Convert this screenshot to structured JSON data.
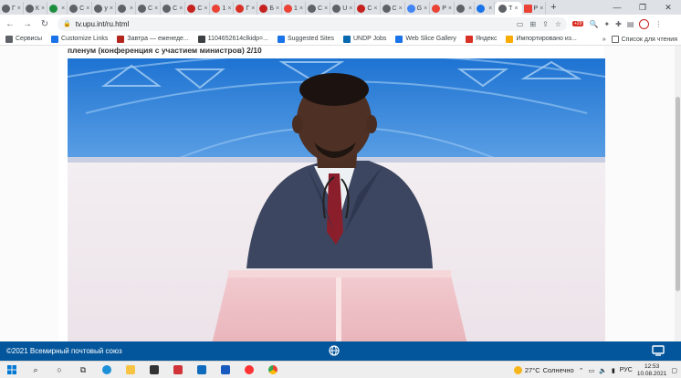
{
  "browser": {
    "tabs": [
      {
        "label": "Г",
        "color": "#5f6368"
      },
      {
        "label": "К",
        "color": "#5f6368"
      },
      {
        "label": "",
        "color": "#1e8e3e"
      },
      {
        "label": "С",
        "color": "#5f6368"
      },
      {
        "label": "у",
        "color": "#5f6368"
      },
      {
        "label": "",
        "color": "#5f6368"
      },
      {
        "label": "С",
        "color": "#5f6368"
      },
      {
        "label": "С",
        "color": "#5f6368"
      },
      {
        "label": "С",
        "color": "#c5221f"
      },
      {
        "label": "1",
        "color": "#ea4335"
      },
      {
        "label": "Г",
        "color": "#d93025"
      },
      {
        "label": "Б",
        "color": "#c5221f"
      },
      {
        "label": "1",
        "color": "#ea4335"
      },
      {
        "label": "С",
        "color": "#5f6368"
      },
      {
        "label": "U",
        "color": "#5f6368"
      },
      {
        "label": "С",
        "color": "#c5221f"
      },
      {
        "label": "С",
        "color": "#5f6368"
      },
      {
        "label": "G",
        "color": "#4285f4"
      },
      {
        "label": "P",
        "color": "#ea4335"
      },
      {
        "label": "",
        "color": "#5f6368"
      },
      {
        "label": "",
        "color": "#1a73e8"
      }
    ],
    "active_tab": {
      "label": "Т"
    },
    "last_tab": {
      "label": "P"
    },
    "url": "tv.upu.int/ru.html",
    "ext_badge": "+29",
    "bookmarks": [
      {
        "label": "Сервисы",
        "color": "#5f6368"
      },
      {
        "label": "Customize Links",
        "color": "#1a73e8"
      },
      {
        "label": "Завтра — еженеде...",
        "color": "#b3261e"
      },
      {
        "label": "1104652614clkidp=...",
        "color": "#3c4043"
      },
      {
        "label": "Suggested Sites",
        "color": "#1a73e8"
      },
      {
        "label": "UNDP Jobs",
        "color": "#0468b1"
      },
      {
        "label": "Web Slice Gallery",
        "color": "#1a73e8"
      },
      {
        "label": "Яндекс",
        "color": "#d93025"
      },
      {
        "label": "Импортировано из...",
        "color": "#f9ab00"
      }
    ],
    "bookmarks_more": "»",
    "reading_list": "Список для чтения"
  },
  "page": {
    "title": "пленум (конференция с участием министров) 2/10"
  },
  "footer": {
    "copyright": "©2021 Всемирный почтовый союз"
  },
  "taskbar": {
    "weather_temp": "27°C",
    "weather_desc": "Солнечно",
    "lang": "РУС",
    "time": "12:53",
    "date": "10.08.2021"
  }
}
